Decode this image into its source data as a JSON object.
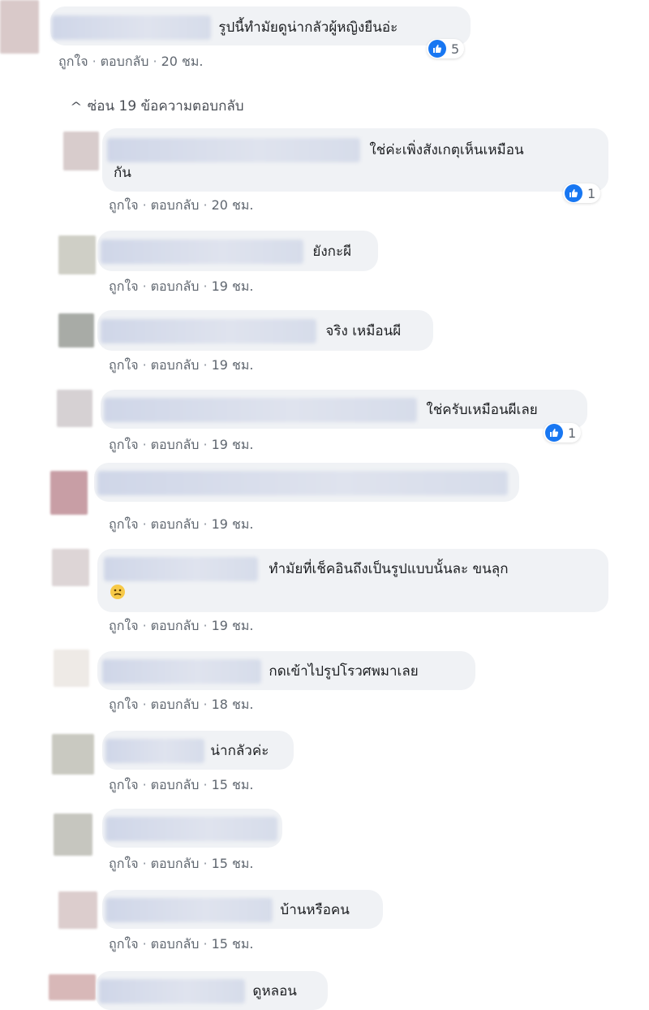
{
  "actions": {
    "like": "ถูกใจ",
    "reply": "ตอบกลับ",
    "sep": "·"
  },
  "hide_replies": "ซ่อน 19 ข้อความตอบกลับ",
  "comments": [
    {
      "text": "รูปนี้ทำมัยดูน่ากลัวผู้หญิงยืนอ่ะ",
      "time": "20 ชม.",
      "likes": "5"
    },
    {
      "text_line1": "ใช่ค่ะเพิ่งสังเกตุเห็นเหมือน",
      "text_line2": "กัน",
      "time": "20 ชม.",
      "likes": "1"
    },
    {
      "text": "ยังกะผี",
      "time": "19 ชม."
    },
    {
      "text": "จริง เหมือนผี",
      "time": "19 ชม."
    },
    {
      "text": "ใช่ครับเหมือนผีเลย",
      "time": "19 ชม.",
      "likes": "1"
    },
    {
      "text": "",
      "time": "19 ชม."
    },
    {
      "text": "ทำมัยที่เช็คอินถึงเป็นรูปแบบนั้นละ ขนลุก",
      "time": "19 ชม.",
      "emoji": "sad-face"
    },
    {
      "text": "กดเข้าไปรูปโรวศพมาเลย",
      "time": "18 ชม."
    },
    {
      "text": "น่ากลัวค่ะ",
      "time": "15 ชม."
    },
    {
      "text": "",
      "time": "15 ชม."
    },
    {
      "text": "บ้านหรือคน",
      "time": "15 ชม."
    },
    {
      "text": "ดูหลอน"
    }
  ]
}
